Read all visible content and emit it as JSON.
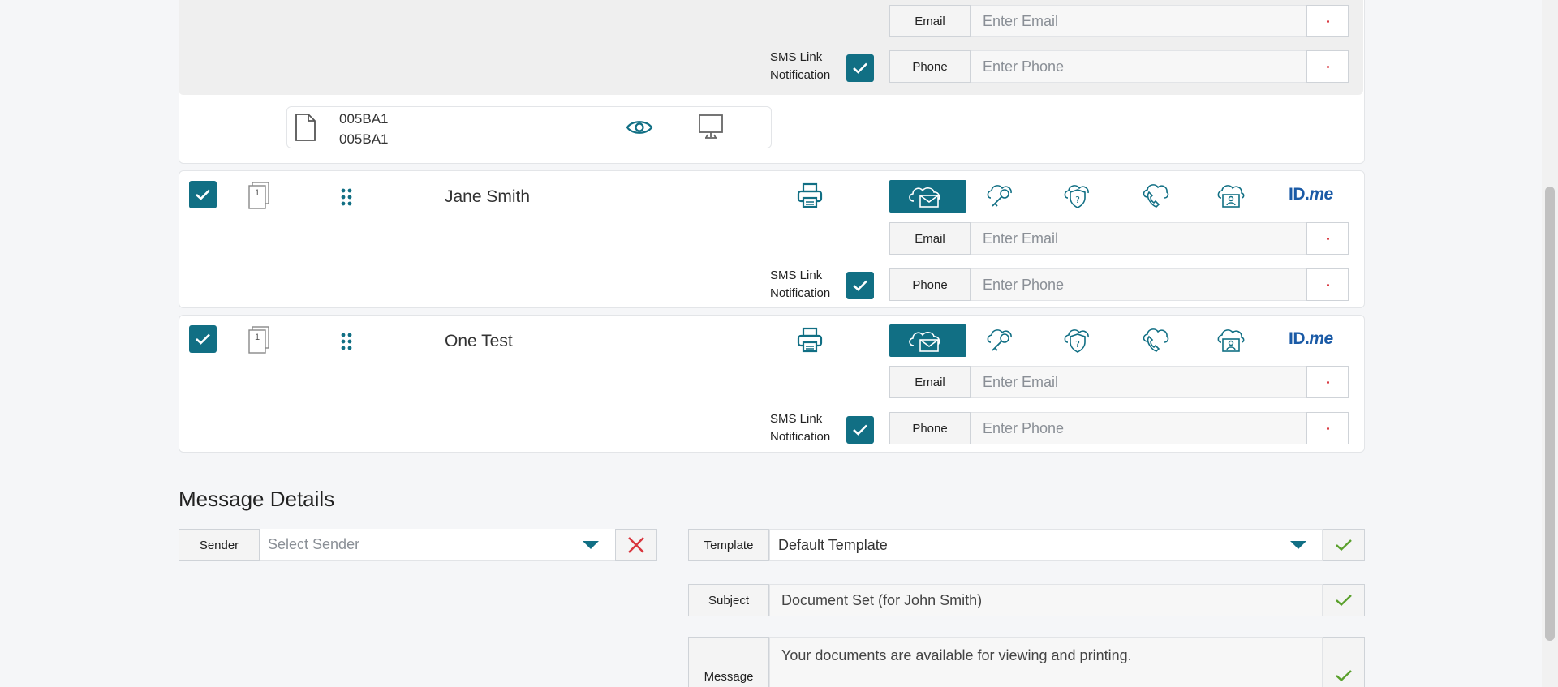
{
  "rows": [
    {
      "name": "",
      "email_label": "Email",
      "email_placeholder": "Enter Email",
      "phone_label": "Phone",
      "phone_placeholder": "Enter Phone",
      "sms_line1": "SMS Link",
      "sms_line2": "Notification"
    },
    {
      "name": "Jane Smith",
      "page_badge": "1",
      "email_label": "Email",
      "email_placeholder": "Enter Email",
      "phone_label": "Phone",
      "phone_placeholder": "Enter Phone",
      "sms_line1": "SMS Link",
      "sms_line2": "Notification",
      "idme_text": "ID.",
      "idme_italic": "me"
    },
    {
      "name": "One Test",
      "page_badge": "1",
      "email_label": "Email",
      "email_placeholder": "Enter Email",
      "phone_label": "Phone",
      "phone_placeholder": "Enter Phone",
      "sms_line1": "SMS Link",
      "sms_line2": "Notification",
      "idme_text": "ID.",
      "idme_italic": "me"
    }
  ],
  "document": {
    "line1": "005BA1",
    "line2": "005BA1"
  },
  "message_details": {
    "title": "Message Details",
    "sender_label": "Sender",
    "sender_placeholder": "Select Sender",
    "template_label": "Template",
    "template_value": "Default Template",
    "subject_label": "Subject",
    "subject_value": "Document Set (for John Smith)",
    "message_label": "Message",
    "message_value": "Your documents are available for viewing and printing."
  },
  "colors": {
    "teal": "#116f84",
    "red": "#d9363e",
    "green": "#5aa02c",
    "idme_blue": "#1a5aa6"
  }
}
